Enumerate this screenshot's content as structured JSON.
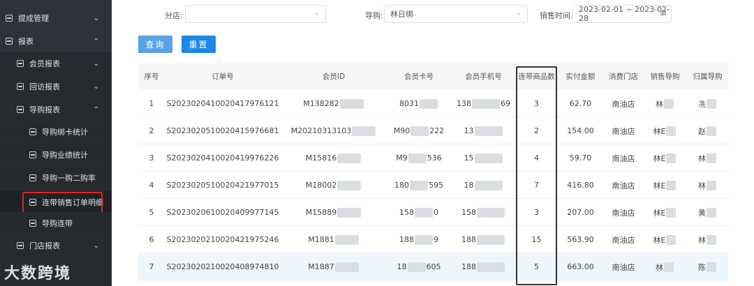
{
  "sidebar": {
    "items": [
      {
        "label": "提成管理",
        "level": 1,
        "chevron": "⌄"
      },
      {
        "label": "报表",
        "level": 1,
        "chevron": "⌃"
      },
      {
        "label": "会员报表",
        "level": 2,
        "chevron": "⌄"
      },
      {
        "label": "回访报表",
        "level": 2,
        "chevron": "⌄"
      },
      {
        "label": "导购报表",
        "level": 2,
        "chevron": "⌃"
      },
      {
        "label": "导购绑卡统计",
        "level": 3
      },
      {
        "label": "导购业绩统计",
        "level": 3
      },
      {
        "label": "导购一购二购率",
        "level": 3
      },
      {
        "label": "连带销售订单明细",
        "level": 3,
        "active": true
      },
      {
        "label": "导购连带",
        "level": 3
      },
      {
        "label": "门店报表",
        "level": 2,
        "chevron": "⌄"
      }
    ],
    "watermark": "大数跨境"
  },
  "filters": {
    "store_label": "分店:",
    "store_value": "",
    "guide_label": "导购:",
    "guide_value": "林日绑",
    "time_label": "销售时间...",
    "time_value": "2023-02-01 ~ 2023-02-28"
  },
  "buttons": {
    "query": "查询",
    "reset": "重置"
  },
  "table": {
    "columns": [
      "序号",
      "订单号",
      "会员ID",
      "会员卡号",
      "会员手机号",
      "连带商品数",
      "实付金额",
      "消费门店",
      "销售导购",
      "归属导购"
    ],
    "rows": [
      {
        "no": "1",
        "order": "S2023020410020417976121",
        "member_id": "M138282",
        "card": "8031",
        "phone": "138",
        "phone_tail": "69",
        "qty": "3",
        "amount": "62.70",
        "store": "南油店",
        "sales": "林",
        "owner": "冼"
      },
      {
        "no": "2",
        "order": "S2023020510020415976681",
        "member_id": "M20210313103",
        "card": "M90",
        "card_tail": "222",
        "phone": "13",
        "qty": "2",
        "amount": "154.00",
        "store": "南油店",
        "sales": "林E",
        "owner": "赵"
      },
      {
        "no": "3",
        "order": "S2023020410020419976226",
        "member_id": "M15816",
        "card": "M9",
        "card_tail": "536",
        "phone": "15",
        "qty": "4",
        "amount": "59.70",
        "store": "南油店",
        "sales": "林E",
        "owner": "林"
      },
      {
        "no": "4",
        "order": "S2023020510020421977015",
        "member_id": "M18002",
        "card": "180",
        "card_tail": "595",
        "phone": "18",
        "qty": "7",
        "amount": "416.80",
        "store": "南油店",
        "sales": "林E",
        "owner": "林"
      },
      {
        "no": "5",
        "order": "S2023020610020409977145",
        "member_id": "M15889",
        "card": "158",
        "card_tail": "0",
        "phone": "158",
        "qty": "3",
        "amount": "207.00",
        "store": "南油店",
        "sales": "林E",
        "owner": "黄"
      },
      {
        "no": "6",
        "order": "S2023020210020421975246",
        "member_id": "M1881",
        "card": "188",
        "card_tail": "9",
        "phone": "188",
        "qty": "15",
        "amount": "563.90",
        "store": "南油店",
        "sales": "林E",
        "owner": "林"
      },
      {
        "no": "7",
        "order": "S2023020210020408974810",
        "member_id": "M1887",
        "card": "18",
        "card_tail": "605",
        "phone": "188",
        "qty": "5",
        "amount": "663.00",
        "store": "南油店",
        "sales": "林",
        "owner": "陈"
      }
    ]
  }
}
